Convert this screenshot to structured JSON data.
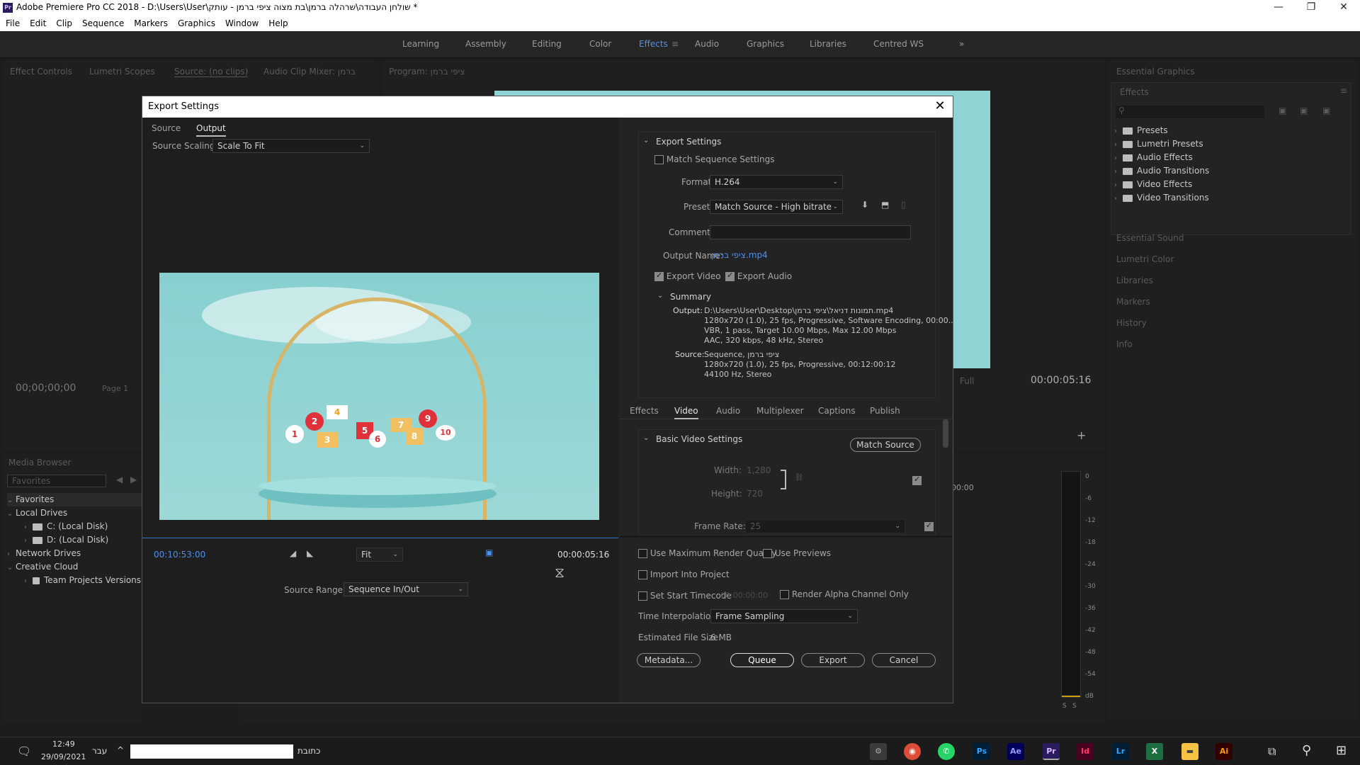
{
  "app": {
    "title": "Adobe Premiere Pro CC 2018 - D:\\Users\\User\\שולחן העבודה\\שרהלה ברמן\\בת מצוה ציפי ברמן - עותק *",
    "logo_text": "Pr"
  },
  "menu": [
    "File",
    "Edit",
    "Clip",
    "Sequence",
    "Markers",
    "Graphics",
    "Window",
    "Help"
  ],
  "workspaces": [
    "Learning",
    "Assembly",
    "Editing",
    "Color",
    "Effects",
    "Audio",
    "Graphics",
    "Libraries",
    "Centred WS"
  ],
  "active_workspace": "Effects",
  "left_panel": {
    "tabs": [
      "Effect Controls",
      "Lumetri Scopes",
      "Source: (no clips)",
      "Audio Clip Mixer: ברמן"
    ],
    "timecode": "00;00;00;00",
    "page_label": "Page 1"
  },
  "program_tab": "Program: ציפי ברמן",
  "program_right": {
    "zoom": "Full",
    "timecode": "00:00:05:16",
    "timeline_time": "00:00"
  },
  "media_browser": {
    "title": "Media Browser",
    "favorites_select": "Favorites",
    "tree": [
      {
        "label": "Favorites",
        "level": 0
      },
      {
        "label": "Local Drives",
        "level": 0
      },
      {
        "label": "C: (Local Disk)",
        "level": 1
      },
      {
        "label": "D: (Local Disk)",
        "level": 1
      },
      {
        "label": "Network Drives",
        "level": 0
      },
      {
        "label": "Creative Cloud",
        "level": 0
      },
      {
        "label": "Team Projects Versions",
        "level": 1
      }
    ]
  },
  "right_panel": {
    "header": "Essential Graphics",
    "effects_tab": "Effects",
    "effects_items": [
      "Presets",
      "Lumetri Presets",
      "Audio Effects",
      "Audio Transitions",
      "Video Effects",
      "Video Transitions"
    ],
    "collapsed_panels": [
      "Essential Sound",
      "Lumetri Color",
      "Libraries",
      "Markers",
      "History",
      "Info"
    ]
  },
  "meter_ticks": [
    "0",
    "-6",
    "-12",
    "-18",
    "-24",
    "-30",
    "-36",
    "-42",
    "-48",
    "-54",
    "dB"
  ],
  "meter_solo": [
    "S",
    "S"
  ],
  "dialog": {
    "title": "Export Settings",
    "left_tabs": [
      "Source",
      "Output"
    ],
    "active_left_tab": "Output",
    "source_scaling_label": "Source Scaling:",
    "source_scaling_value": "Scale To Fit",
    "preview_numbers": [
      "1",
      "2",
      "3",
      "4",
      "5",
      "6",
      "7",
      "8",
      "9",
      "10"
    ],
    "current_time": "00:10:53:00",
    "fit_value": "Fit",
    "end_time": "00:00:05:16",
    "source_range_label": "Source Range:",
    "source_range_value": "Sequence In/Out",
    "export_settings": {
      "header": "Export Settings",
      "match_sequence": "Match Sequence Settings",
      "format_label": "Format:",
      "format_value": "H.264",
      "preset_label": "Preset:",
      "preset_value": "Match Source - High bitrate",
      "comments_label": "Comments:",
      "output_name_label": "Output Name:",
      "output_name_value": "ציפי ברמן.mp4",
      "export_video": "Export Video",
      "export_audio": "Export Audio",
      "summary_header": "Summary",
      "output_label": "Output:",
      "output_lines": [
        "D:\\Users\\User\\Desktop\\תמונות דניאל\\ציפי ברמן.mp4",
        "1280x720 (1.0), 25 fps, Progressive, Software Encoding, 00:00...",
        "VBR, 1 pass, Target 10.00 Mbps, Max 12.00 Mbps",
        "AAC, 320 kbps, 48 kHz, Stereo"
      ],
      "source_label": "Source:",
      "source_lines": [
        "Sequence, ציפי ברמן",
        "1280x720 (1.0), 25 fps, Progressive, 00:12:00:12",
        "44100 Hz, Stereo"
      ]
    },
    "settings_tabs": [
      "Effects",
      "Video",
      "Audio",
      "Multiplexer",
      "Captions",
      "Publish"
    ],
    "active_settings_tab": "Video",
    "basic_video": {
      "header": "Basic Video Settings",
      "match_source": "Match Source",
      "width_label": "Width:",
      "width_value": "1,280",
      "height_label": "Height:",
      "height_value": "720",
      "frame_rate_label": "Frame Rate:",
      "frame_rate_value": "25"
    },
    "options": {
      "max_render": "Use Maximum Render Quality",
      "use_previews": "Use Previews",
      "import_project": "Import Into Project",
      "set_start_tc": "Set Start Timecode",
      "start_tc_value": "00:00:00:00",
      "alpha_only": "Render Alpha Channel Only",
      "time_interp_label": "Time Interpolation:",
      "time_interp_value": "Frame Sampling",
      "est_size_label": "Estimated File Size:",
      "est_size_value": "6 MB"
    },
    "buttons": {
      "metadata": "Metadata...",
      "queue": "Queue",
      "export": "Export",
      "cancel": "Cancel"
    }
  },
  "taskbar": {
    "time": "12:49",
    "date": "29/09/2021",
    "lang": "עבר",
    "address_label": "כתובת",
    "apps": [
      "Ps",
      "Ae",
      "Pr",
      "Id",
      "Lr",
      "X",
      "Ai"
    ]
  }
}
